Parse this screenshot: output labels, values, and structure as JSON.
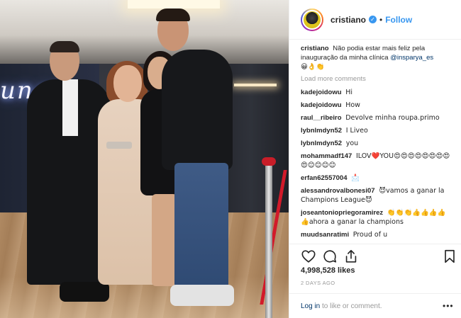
{
  "header": {
    "username": "cristiano",
    "verified_mark": "✓",
    "separator": "•",
    "follow_label": "Follow"
  },
  "photo": {
    "neon_text": "ungo"
  },
  "caption": {
    "username": "cristiano",
    "text": "Não podia estar mais feliz pela inauguração da minha clínica",
    "mention": "@insparya_es",
    "emojis": "😀👌👏"
  },
  "load_more_label": "Load more comments",
  "comments": [
    {
      "user": "kadejoidowu",
      "text": "Hi"
    },
    {
      "user": "kadejoidowu",
      "text": "How"
    },
    {
      "user": "raul__ribeiro",
      "text": "Devolve minha roupa.primo"
    },
    {
      "user": "lybnlmdyn52",
      "text": "I Liveo"
    },
    {
      "user": "lybnlmdyn52",
      "text": "you"
    },
    {
      "user": "mohammadf147",
      "text": "ILOV❤️YOU😍😍😍😍😍😍😍😍😍😊😊😊😊"
    },
    {
      "user": "erfan62557004",
      "text": "📩"
    },
    {
      "user": "alessandrovalbonesi07",
      "text": "😈vamos a ganar la Champions League😈"
    },
    {
      "user": "joseantoniopriegoramirez",
      "text": "👏👏👏👍👍👍👍👍ahora a ganar la champions"
    },
    {
      "user": "muudsanratimi",
      "text": "Proud of u"
    }
  ],
  "likes": "4,998,528 likes",
  "timestamp": "2 DAYS AGO",
  "footer": {
    "login_link": "Log in",
    "login_suffix": "to like or comment.",
    "options": "•••"
  },
  "icons": {
    "like": "heart-icon",
    "comment": "comment-bubble-icon",
    "share": "share-icon",
    "save": "bookmark-icon"
  }
}
